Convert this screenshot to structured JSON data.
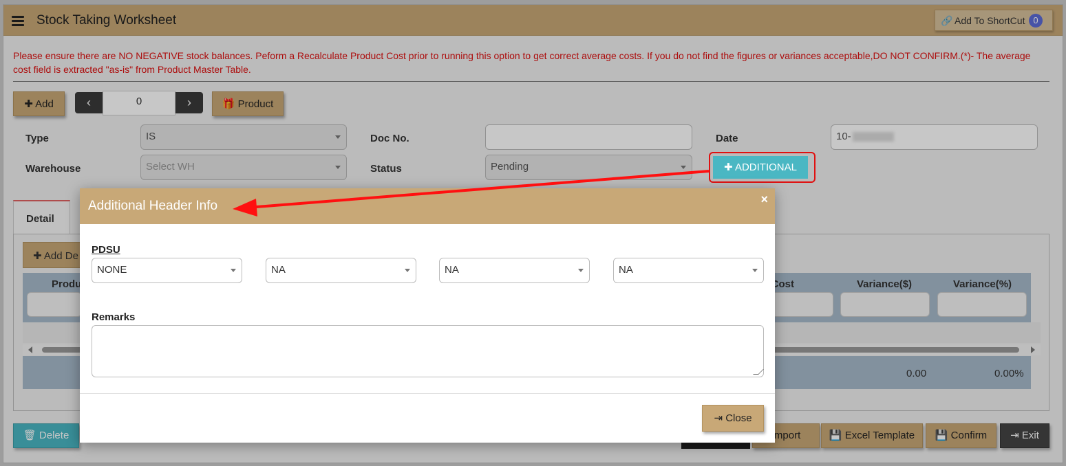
{
  "header": {
    "title": "Stock Taking Worksheet",
    "shortcut_label": "Add To ShortCut",
    "shortcut_count": "0"
  },
  "warning": "Please ensure there are NO NEGATIVE stock balances. Peform a Recalculate Product Cost prior to running this option to get correct average costs. If you do not find the figures or variances acceptable,DO NOT CONFIRM.(*)- The average cost field is extracted \"as-is\" from Product Master Table.",
  "toolbar": {
    "add": "Add",
    "pager_value": "0",
    "product": "Product"
  },
  "form": {
    "type_label": "Type",
    "type_value": "IS",
    "docno_label": "Doc No.",
    "docno_value": "",
    "date_label": "Date",
    "date_value": "10-",
    "warehouse_label": "Warehouse",
    "warehouse_placeholder": "Select WH",
    "status_label": "Status",
    "status_value": "Pending",
    "additional": "ADDITIONAL"
  },
  "tabs": {
    "detail": "Detail"
  },
  "grid": {
    "add_detail": "Add De",
    "columns": {
      "product": "Produ",
      "avg_cost": "vg Cost",
      "variance_amt": "Variance($)",
      "variance_pct": "Variance(%)"
    },
    "totals": {
      "variance_amt": "0.00",
      "variance_pct": "0.00%"
    }
  },
  "footer": {
    "delete": "Delete",
    "import": "Import",
    "excel": "Excel Template",
    "confirm": "Confirm",
    "exit": "Exit"
  },
  "modal": {
    "title": "Additional Header Info",
    "close_x": "×",
    "pdsu_label": "PDSU",
    "selects": [
      "NONE",
      "NA",
      "NA",
      "NA"
    ],
    "remarks_label": "Remarks",
    "close_button": "Close"
  }
}
